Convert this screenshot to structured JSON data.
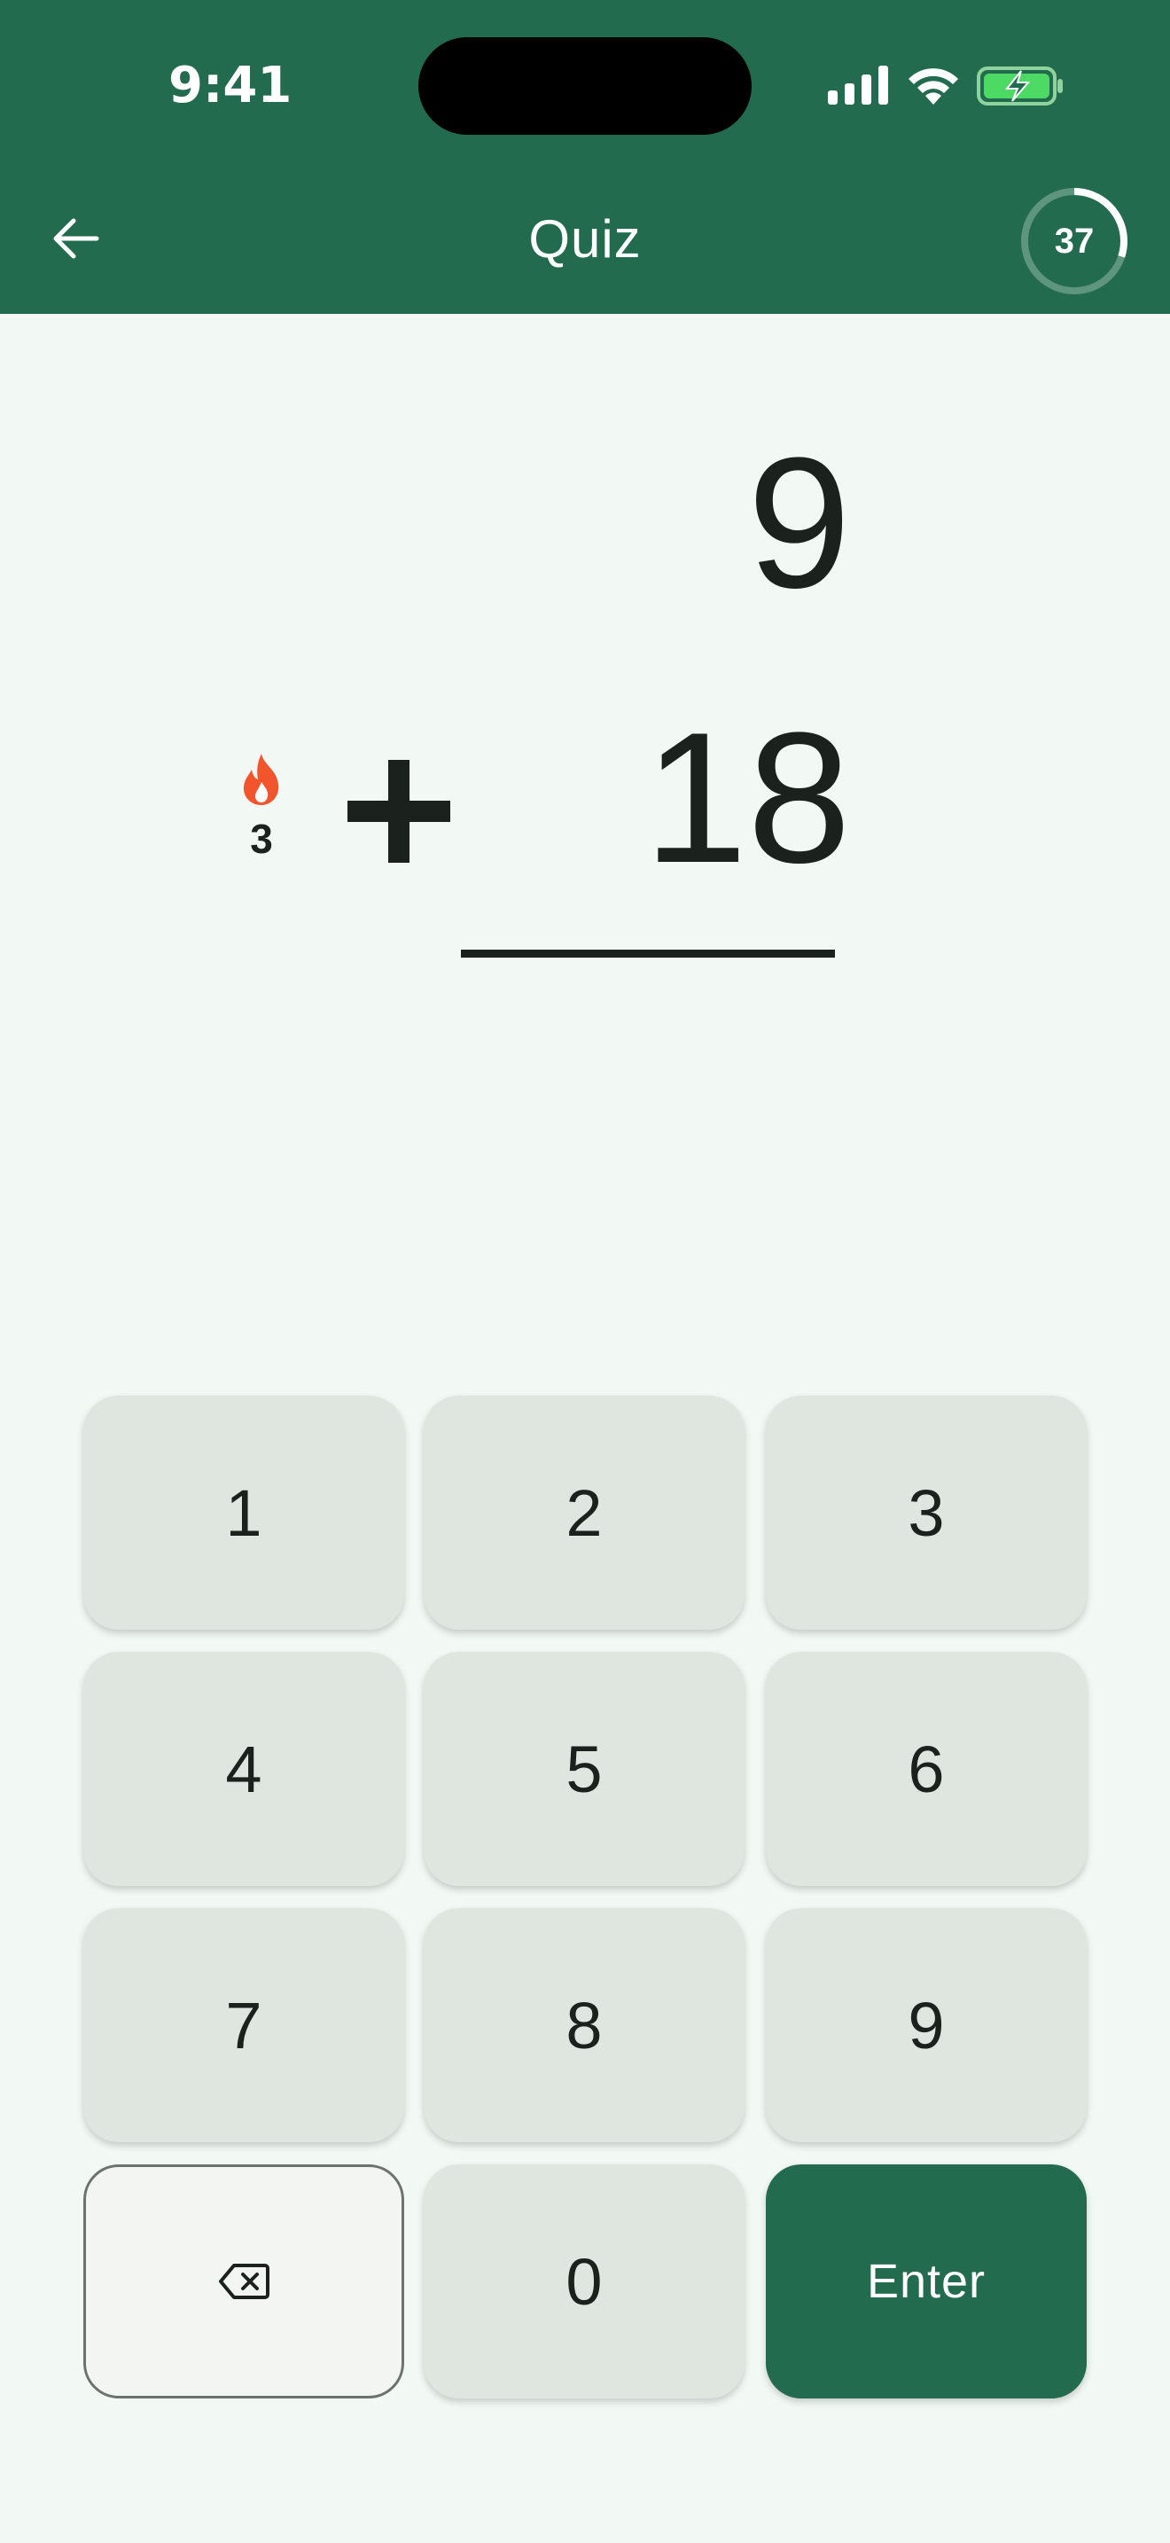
{
  "status_bar": {
    "time": "9:41"
  },
  "nav": {
    "title": "Quiz",
    "back_icon": "arrow-left-icon"
  },
  "timer": {
    "value": "37",
    "progress_fraction": 0.3,
    "ring_color": "#ffffff",
    "track_color": "#5e957e"
  },
  "problem": {
    "top_number": "9",
    "operator": "+",
    "bottom_number": "18",
    "answer": ""
  },
  "streak": {
    "icon": "flame-icon",
    "count": "3",
    "color": "#f2552c"
  },
  "keypad": {
    "keys": [
      "1",
      "2",
      "3",
      "4",
      "5",
      "6",
      "7",
      "8",
      "9"
    ],
    "delete_icon": "backspace-icon",
    "zero": "0",
    "enter": "Enter"
  },
  "colors": {
    "primary": "#236b4f",
    "background": "#f2f8f3",
    "key": "#dfe5df",
    "text": "#1b211d"
  }
}
